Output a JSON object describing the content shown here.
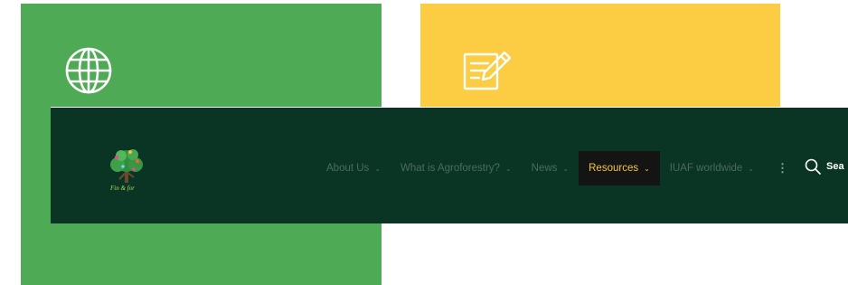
{
  "cards": {
    "green": {
      "color": "#4eaa54",
      "icon": "globe-icon"
    },
    "yellow": {
      "color": "#fccc42",
      "icon": "edit-document-icon"
    }
  },
  "header": {
    "background": "#0a3525",
    "logo": "tree-logo",
    "logo_text": "Fin & for",
    "nav": [
      {
        "label": "About Us",
        "chevron": "⌄"
      },
      {
        "label": "What is Agroforestry?",
        "chevron": "⌄"
      },
      {
        "label": "News",
        "chevron": "⌄"
      },
      {
        "label": "Resources",
        "chevron": "⌄",
        "active": true
      },
      {
        "label": "IUAF worldwide",
        "chevron": "⌄"
      }
    ],
    "more_label": "⋮",
    "search_label": "Sea",
    "accent": "#f4c63d"
  }
}
